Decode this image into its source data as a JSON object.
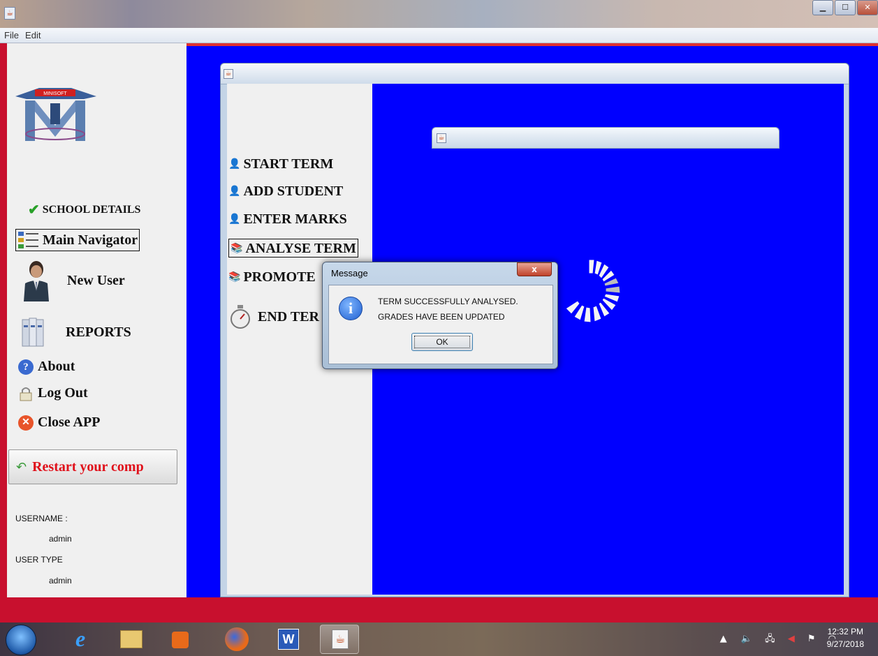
{
  "window": {
    "title": "",
    "controls": [
      "minimize",
      "maximize",
      "close"
    ]
  },
  "menubar": {
    "items": [
      "File",
      "Edit"
    ]
  },
  "sidebar": {
    "logo_text": "MINISOFT",
    "items": {
      "school_details": "SCHOOL DETAILS",
      "main_navigator": "Main Navigator",
      "new_user": "New User",
      "reports": "REPORTS",
      "about": "About",
      "log_out": "Log Out",
      "close_app": "Close APP"
    },
    "restart_button": "Restart your comp",
    "username_label": "USERNAME :",
    "username_value": "admin",
    "user_type_label": "USER TYPE",
    "user_type_value": "admin"
  },
  "term_menu": {
    "items": {
      "start_term": "START TERM",
      "add_student": "ADD STUDENT",
      "enter_marks": "ENTER MARKS",
      "analyse_term": "ANALYSE TERM",
      "promote": "PROMOTE",
      "end_term": "END TER"
    }
  },
  "dialog": {
    "title": "Message",
    "close_label": "x",
    "line1": "TERM SUCCESSFULLY ANALYSED.",
    "line2": "GRADES HAVE BEEN UPDATED",
    "ok_label": "OK"
  },
  "taskbar": {
    "time": "12:32 PM",
    "date": "9/27/2018"
  },
  "colors": {
    "desktop_blue": "#0000ff",
    "restart_text": "#e0101a",
    "panel_gray": "#f0f0f0"
  }
}
